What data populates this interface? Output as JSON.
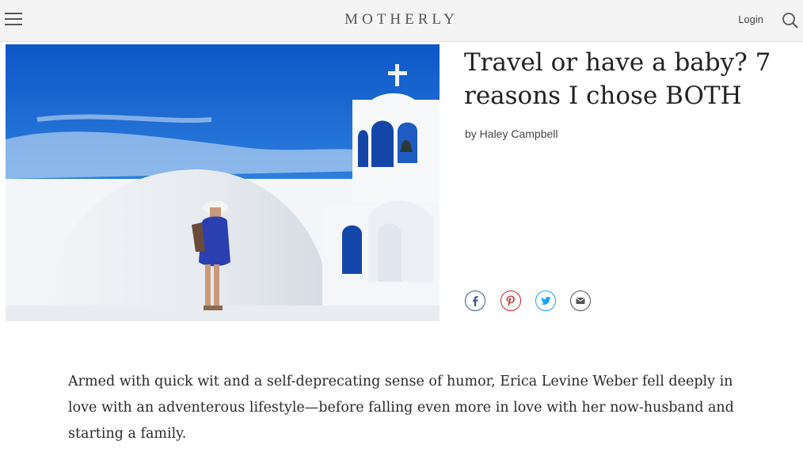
{
  "header": {
    "brand": "MOTHERLY",
    "login_label": "Login",
    "menu_icon": "hamburger-menu-icon",
    "search_icon": "search-icon"
  },
  "article": {
    "title": "Travel or have a baby? 7 reasons I chose BOTH",
    "byline": "by Haley Campbell",
    "intro": "Armed with quick wit and a self-deprecating sense of humor, Erica Levine Weber fell deeply in love with an adventerous lifestyle—before falling even more in love with her now-husband and starting a family."
  },
  "share": [
    {
      "icon": "facebook-icon",
      "color": "#3b5998"
    },
    {
      "icon": "pinterest-icon",
      "color": "#cb2027"
    },
    {
      "icon": "twitter-icon",
      "color": "#1da1f2"
    },
    {
      "icon": "email-icon",
      "color": "#555555"
    }
  ],
  "colors": {
    "header_bg": "#f4f4f4",
    "sky": "#1f6fd1",
    "text": "#222222"
  }
}
